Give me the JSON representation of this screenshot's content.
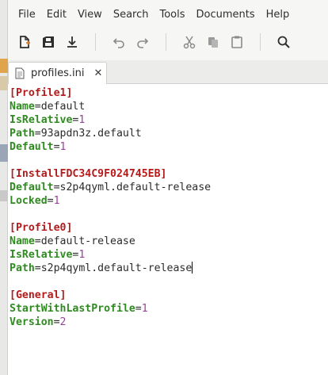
{
  "menubar": {
    "items": [
      "File",
      "Edit",
      "View",
      "Search",
      "Tools",
      "Documents",
      "Help"
    ]
  },
  "toolbar": {
    "icons": [
      "new-file-icon",
      "save-icon",
      "download-icon",
      "undo-icon",
      "redo-icon",
      "cut-icon",
      "copy-icon",
      "paste-icon",
      "search-icon"
    ]
  },
  "tab": {
    "label": "profiles.ini",
    "close": "✕"
  },
  "editor": {
    "lines": [
      {
        "type": "section",
        "text": "[Profile1]"
      },
      {
        "type": "kv",
        "key": "Name",
        "value": "default"
      },
      {
        "type": "kvnum",
        "key": "IsRelative",
        "value": "1"
      },
      {
        "type": "kv",
        "key": "Path",
        "value": "93apdn3z.default"
      },
      {
        "type": "kvnum",
        "key": "Default",
        "value": "1"
      },
      {
        "type": "blank"
      },
      {
        "type": "section",
        "text": "[InstallFDC34C9F024745EB]"
      },
      {
        "type": "kv",
        "key": "Default",
        "value": "s2p4qyml.default-release"
      },
      {
        "type": "kvnum",
        "key": "Locked",
        "value": "1"
      },
      {
        "type": "blank"
      },
      {
        "type": "section",
        "text": "[Profile0]"
      },
      {
        "type": "kv",
        "key": "Name",
        "value": "default-release"
      },
      {
        "type": "kvnum",
        "key": "IsRelative",
        "value": "1"
      },
      {
        "type": "kv",
        "key": "Path",
        "value": "s2p4qyml.default-release",
        "caret": true
      },
      {
        "type": "blank"
      },
      {
        "type": "section",
        "text": "[General]"
      },
      {
        "type": "kvnum",
        "key": "StartWithLastProfile",
        "value": "1"
      },
      {
        "type": "kvnum",
        "key": "Version",
        "value": "2"
      }
    ]
  }
}
